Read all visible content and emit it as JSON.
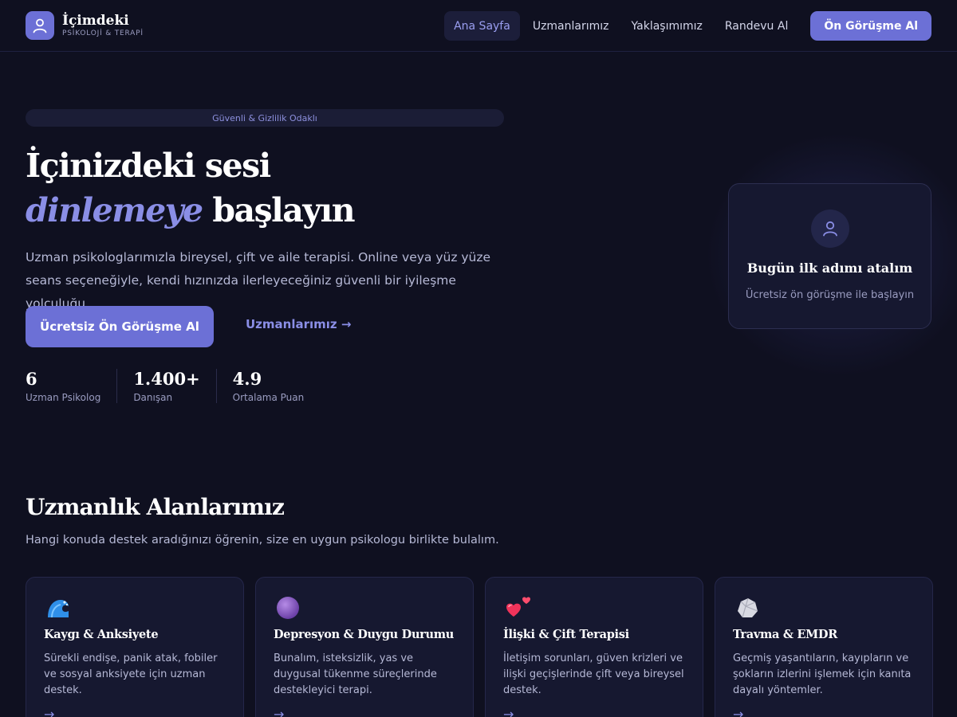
{
  "brand": {
    "name": "İçimdeki",
    "tagline": "PSİKOLOJİ & TERAPİ",
    "icon": "user-icon",
    "accent": "#6c70d6"
  },
  "nav": {
    "items": [
      {
        "label": "Ana Sayfa",
        "active": true
      },
      {
        "label": "Uzmanlarımız",
        "active": false
      },
      {
        "label": "Yaklaşımımız",
        "active": false
      },
      {
        "label": "Randevu Al",
        "active": false
      }
    ],
    "cta": "Ön Görüşme Al"
  },
  "hero": {
    "pill": "Güvenli & Gizlilik Odaklı",
    "title_line1": "İçinizdeki sesi",
    "title_accent": "dinlemeye",
    "title_line2_rest": " başlayın",
    "description": "Uzman psikologlarımızla bireysel, çift ve aile terapisi. Online veya yüz yüze seans seçeneğiyle, kendi hızınızda ilerleyeceğiniz güvenli bir iyileşme yolculuğu.",
    "primary_button": "Ücretsiz Ön Görüşme Al",
    "secondary_link": "Uzmanlarımız →",
    "stats": [
      {
        "value": "6",
        "label": "Uzman Psikolog"
      },
      {
        "value": "1.400+",
        "label": "Danışan"
      },
      {
        "value": "4.9",
        "label": "Ortalama Puan"
      }
    ]
  },
  "hero_card": {
    "icon": "user-icon",
    "title": "Bugün ilk adımı atalım",
    "subtitle": "Ücretsiz ön görüşme ile başlayın"
  },
  "expertise": {
    "title": "Uzmanlık Alanlarımız",
    "subtitle": "Hangi konuda destek aradığınızı öğrenin, size en uygun psikologu birlikte bulalım.",
    "cards": [
      {
        "icon": "wave-icon",
        "title": "Kaygı & Anksiyete",
        "description": "Sürekli endişe, panik atak, fobiler ve sosyal anksiyete için uzman destek.",
        "arrow": "→"
      },
      {
        "icon": "purple-circle-icon",
        "title": "Depresyon & Duygu Durumu",
        "description": "Bunalım, isteksizlik, yas ve duygusal tükenme süreçlerinde destekleyici terapi.",
        "arrow": "→"
      },
      {
        "icon": "two-hearts-icon",
        "title": "İlişki & Çift Terapisi",
        "description": "İletişim sorunları, güven krizleri ve ilişki geçişlerinde çift veya bireysel destek.",
        "arrow": "→"
      },
      {
        "icon": "rock-icon",
        "title": "Travma & EMDR",
        "description": "Geçmiş yaşantıların, kayıpların ve şokların izlerini işlemek için kanıta dayalı yöntemler.",
        "arrow": "→"
      }
    ]
  }
}
